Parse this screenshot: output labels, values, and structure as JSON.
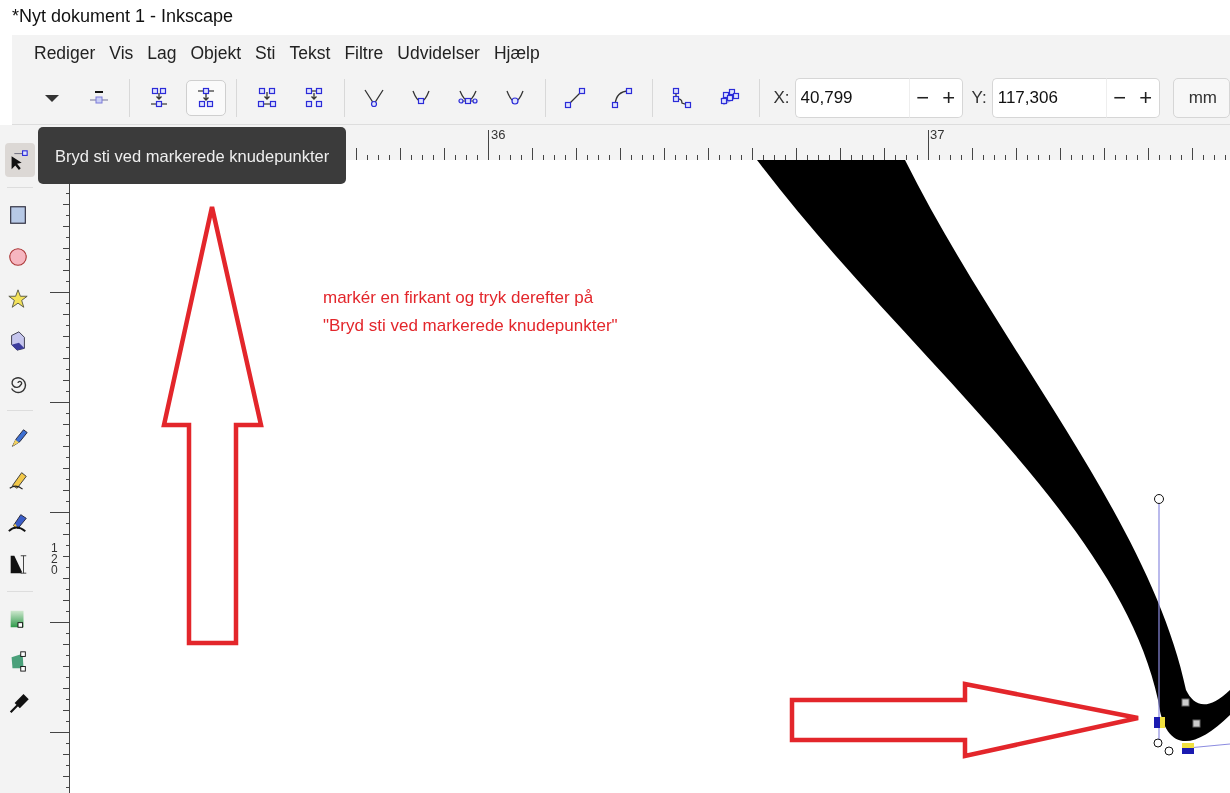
{
  "window": {
    "title": "*Nyt dokument 1 - Inkscape"
  },
  "menu": [
    "Rediger",
    "Vis",
    "Lag",
    "Objekt",
    "Sti",
    "Tekst",
    "Filtre",
    "Udvidelser",
    "Hjælp"
  ],
  "toolbar": {
    "groups": [
      [
        {
          "kind": "caret",
          "selected": false
        },
        {
          "kind": "delete",
          "selected": false
        }
      ],
      [
        {
          "kind": "join",
          "selected": false
        },
        {
          "kind": "break",
          "selected": true
        }
      ],
      [
        {
          "kind": "join-ends",
          "selected": false
        },
        {
          "kind": "delete-segment",
          "selected": false
        }
      ],
      [
        {
          "kind": "cusp",
          "selected": false
        },
        {
          "kind": "smooth",
          "selected": false
        },
        {
          "kind": "symmetric",
          "selected": false
        },
        {
          "kind": "auto",
          "selected": false
        }
      ],
      [
        {
          "kind": "line",
          "selected": false
        },
        {
          "kind": "curve",
          "selected": false
        }
      ],
      [
        {
          "kind": "object-to-path",
          "selected": false
        },
        {
          "kind": "stroke-to-path",
          "selected": false
        }
      ]
    ],
    "fields": [
      {
        "label": "X:",
        "value": "40,799",
        "minus": "−",
        "plus": "+"
      },
      {
        "label": "Y:",
        "value": "117,306",
        "minus": "−",
        "plus": "+"
      }
    ],
    "unit": "mm"
  },
  "ruler": {
    "labels": [
      "36",
      "37"
    ],
    "vertical_label": "120"
  },
  "tools": [
    [
      {
        "kind": "node",
        "selected": true
      }
    ],
    [
      {
        "kind": "rect",
        "selected": false
      },
      {
        "kind": "circle",
        "selected": false
      },
      {
        "kind": "star",
        "selected": false
      },
      {
        "kind": "box3d",
        "selected": false
      },
      {
        "kind": "spiral",
        "selected": false
      }
    ],
    [
      {
        "kind": "pen",
        "selected": false
      },
      {
        "kind": "pencil",
        "selected": false
      },
      {
        "kind": "calligraphy",
        "selected": false
      },
      {
        "kind": "text",
        "selected": false
      }
    ],
    [
      {
        "kind": "gradient",
        "selected": false
      },
      {
        "kind": "mesh",
        "selected": false
      },
      {
        "kind": "dropper",
        "selected": false
      }
    ]
  ],
  "tooltip": "Bryd sti ved markerede knudepunkter",
  "annotation": [
    "markér en firkant og tryk derefter på",
    "\"Bryd sti ved markerede knudepunkter\""
  ]
}
